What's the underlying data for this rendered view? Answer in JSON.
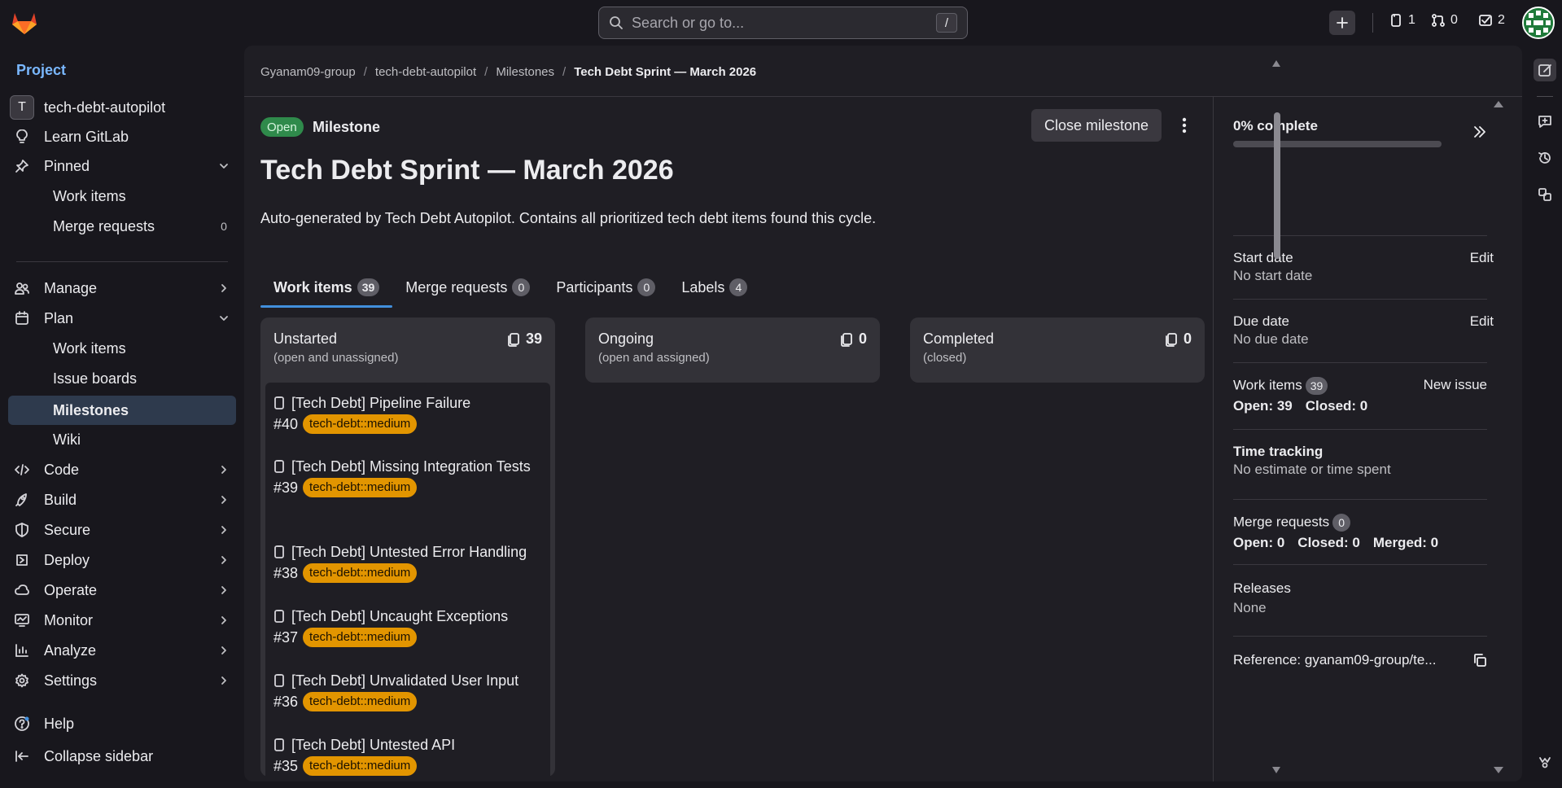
{
  "colors": {
    "accent": "#428fdc",
    "open_badge": "#2f8a4b",
    "label_chip": "#e29500",
    "sidebar_active": "#2e3a4d"
  },
  "topbar": {
    "search_placeholder": "Search or go to...",
    "search_shortcut": "/",
    "issues_count": "1",
    "merge_requests_count": "0",
    "todos_count": "2"
  },
  "sidebar": {
    "heading": "Project",
    "project_initial": "T",
    "project_name": "tech-debt-autopilot",
    "learn": "Learn GitLab",
    "pinned": "Pinned",
    "pinned_items": [
      {
        "label": "Work items",
        "count": ""
      },
      {
        "label": "Merge requests",
        "count": "0"
      }
    ],
    "manage": "Manage",
    "plan": "Plan",
    "plan_items": [
      "Work items",
      "Issue boards",
      "Milestones",
      "Wiki"
    ],
    "groups": [
      "Code",
      "Build",
      "Secure",
      "Deploy",
      "Operate",
      "Monitor",
      "Analyze",
      "Settings"
    ],
    "help": "Help",
    "collapse": "Collapse sidebar"
  },
  "breadcrumb": [
    "Gyanam09-group",
    "tech-debt-autopilot",
    "Milestones",
    "Tech Debt Sprint — March 2026"
  ],
  "milestone": {
    "status": "Open",
    "kind": "Milestone",
    "close_button": "Close milestone",
    "title": "Tech Debt Sprint — March 2026",
    "description": "Auto-generated by Tech Debt Autopilot. Contains all prioritized tech debt items found this cycle."
  },
  "tabs": [
    {
      "label": "Work items",
      "count": "39"
    },
    {
      "label": "Merge requests",
      "count": "0"
    },
    {
      "label": "Participants",
      "count": "0"
    },
    {
      "label": "Labels",
      "count": "4"
    }
  ],
  "columns": [
    {
      "title": "Unstarted",
      "subtitle": "(open and unassigned)",
      "count": "39"
    },
    {
      "title": "Ongoing",
      "subtitle": "(open and assigned)",
      "count": "0"
    },
    {
      "title": "Completed",
      "subtitle": "(closed)",
      "count": "0"
    }
  ],
  "unstarted_items": [
    {
      "title": "[Tech Debt] Pipeline Failure",
      "ref": "#40",
      "label": "tech-debt::medium"
    },
    {
      "title": "[Tech Debt] Missing Integration Tests",
      "ref": "#39",
      "label": "tech-debt::medium"
    },
    {
      "title": "[Tech Debt] Untested Error Handling",
      "ref": "#38",
      "label": "tech-debt::medium"
    },
    {
      "title": "[Tech Debt] Uncaught Exceptions",
      "ref": "#37",
      "label": "tech-debt::medium"
    },
    {
      "title": "[Tech Debt] Unvalidated User Input",
      "ref": "#36",
      "label": "tech-debt::medium"
    },
    {
      "title": "[Tech Debt] Untested API",
      "ref": "#35",
      "label": "tech-debt::medium"
    }
  ],
  "details": {
    "progress_text": "0% complete",
    "progress_value": 0,
    "start_label": "Start date",
    "start_value": "No start date",
    "due_label": "Due date",
    "due_value": "No due date",
    "edit": "Edit",
    "work_items_label": "Work items",
    "work_items_count": "39",
    "new_issue": "New issue",
    "work_open": "Open: 39",
    "work_closed": "Closed: 0",
    "time_label": "Time tracking",
    "time_value": "No estimate or time spent",
    "mr_label": "Merge requests",
    "mr_count": "0",
    "mr_open": "Open: 0",
    "mr_closed": "Closed: 0",
    "mr_merged": "Merged: 0",
    "releases_label": "Releases",
    "releases_value": "None",
    "reference": "Reference: gyanam09-group/te..."
  }
}
